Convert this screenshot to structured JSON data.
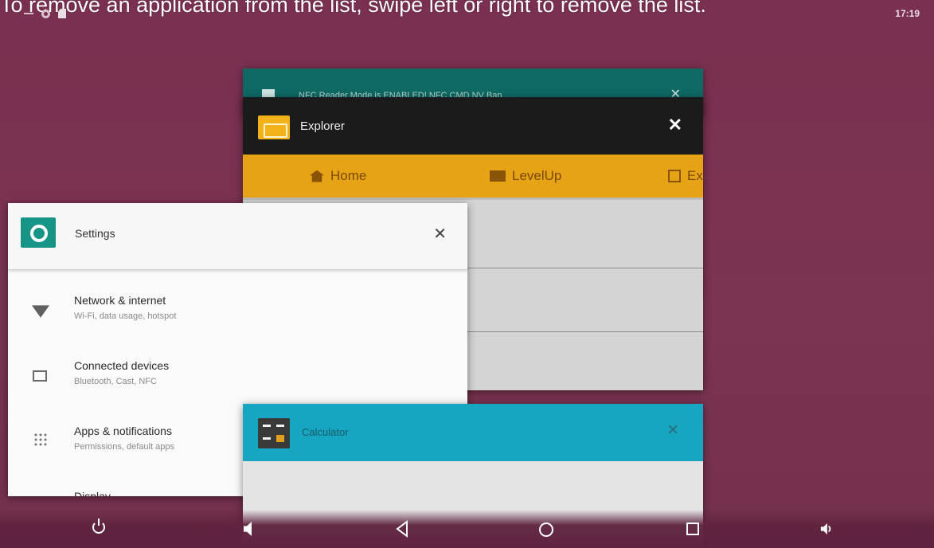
{
  "caption": "To remove an application from the list, swipe left or right to remove the list.",
  "status_bar": {
    "time": "17:19",
    "icons": [
      "dash-icon",
      "settings-status-icon",
      "sdcard-icon"
    ]
  },
  "cards": {
    "back_card": {
      "title": "NFC Reader Mode is ENABLED! NFC CMD NV Ban... ...",
      "close": "✕"
    },
    "explorer": {
      "title": "Explorer",
      "close": "✕",
      "tabs": [
        {
          "label": "Home",
          "icon": "home-icon"
        },
        {
          "label": "LevelUp",
          "icon": "folder-up-icon"
        },
        {
          "label": "Ex",
          "icon": "exit-icon"
        }
      ]
    },
    "settings": {
      "title": "Settings",
      "close": "✕",
      "items": [
        {
          "title": "Network & internet",
          "subtitle": "Wi-Fi, data usage, hotspot",
          "icon": "wifi-icon"
        },
        {
          "title": "Connected devices",
          "subtitle": "Bluetooth, Cast, NFC",
          "icon": "devices-icon"
        },
        {
          "title": "Apps & notifications",
          "subtitle": "Permissions, default apps",
          "icon": "apps-icon"
        },
        {
          "title": "Display",
          "subtitle": "",
          "icon": "display-icon"
        }
      ]
    },
    "calculator": {
      "title": "Calculator",
      "close": "✕"
    }
  },
  "navbar": {
    "buttons": [
      "power-icon",
      "volume-down-icon",
      "back-icon",
      "home-icon",
      "recents-icon",
      "volume-up-icon"
    ]
  },
  "colors": {
    "wallpaper": "#7a3050",
    "explorer_bar": "#e6a316",
    "settings_accent": "#169485",
    "calculator_accent": "#16a6c2"
  }
}
